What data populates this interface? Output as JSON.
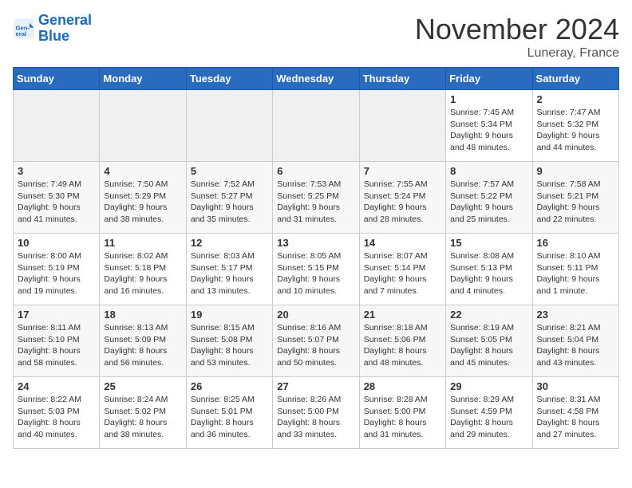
{
  "logo": {
    "text_general": "General",
    "text_blue": "Blue"
  },
  "header": {
    "month": "November 2024",
    "location": "Luneray, France"
  },
  "weekdays": [
    "Sunday",
    "Monday",
    "Tuesday",
    "Wednesday",
    "Thursday",
    "Friday",
    "Saturday"
  ],
  "weeks": [
    [
      {
        "day": "",
        "info": ""
      },
      {
        "day": "",
        "info": ""
      },
      {
        "day": "",
        "info": ""
      },
      {
        "day": "",
        "info": ""
      },
      {
        "day": "",
        "info": ""
      },
      {
        "day": "1",
        "info": "Sunrise: 7:45 AM\nSunset: 5:34 PM\nDaylight: 9 hours\nand 48 minutes."
      },
      {
        "day": "2",
        "info": "Sunrise: 7:47 AM\nSunset: 5:32 PM\nDaylight: 9 hours\nand 44 minutes."
      }
    ],
    [
      {
        "day": "3",
        "info": "Sunrise: 7:49 AM\nSunset: 5:30 PM\nDaylight: 9 hours\nand 41 minutes."
      },
      {
        "day": "4",
        "info": "Sunrise: 7:50 AM\nSunset: 5:29 PM\nDaylight: 9 hours\nand 38 minutes."
      },
      {
        "day": "5",
        "info": "Sunrise: 7:52 AM\nSunset: 5:27 PM\nDaylight: 9 hours\nand 35 minutes."
      },
      {
        "day": "6",
        "info": "Sunrise: 7:53 AM\nSunset: 5:25 PM\nDaylight: 9 hours\nand 31 minutes."
      },
      {
        "day": "7",
        "info": "Sunrise: 7:55 AM\nSunset: 5:24 PM\nDaylight: 9 hours\nand 28 minutes."
      },
      {
        "day": "8",
        "info": "Sunrise: 7:57 AM\nSunset: 5:22 PM\nDaylight: 9 hours\nand 25 minutes."
      },
      {
        "day": "9",
        "info": "Sunrise: 7:58 AM\nSunset: 5:21 PM\nDaylight: 9 hours\nand 22 minutes."
      }
    ],
    [
      {
        "day": "10",
        "info": "Sunrise: 8:00 AM\nSunset: 5:19 PM\nDaylight: 9 hours\nand 19 minutes."
      },
      {
        "day": "11",
        "info": "Sunrise: 8:02 AM\nSunset: 5:18 PM\nDaylight: 9 hours\nand 16 minutes."
      },
      {
        "day": "12",
        "info": "Sunrise: 8:03 AM\nSunset: 5:17 PM\nDaylight: 9 hours\nand 13 minutes."
      },
      {
        "day": "13",
        "info": "Sunrise: 8:05 AM\nSunset: 5:15 PM\nDaylight: 9 hours\nand 10 minutes."
      },
      {
        "day": "14",
        "info": "Sunrise: 8:07 AM\nSunset: 5:14 PM\nDaylight: 9 hours\nand 7 minutes."
      },
      {
        "day": "15",
        "info": "Sunrise: 8:08 AM\nSunset: 5:13 PM\nDaylight: 9 hours\nand 4 minutes."
      },
      {
        "day": "16",
        "info": "Sunrise: 8:10 AM\nSunset: 5:11 PM\nDaylight: 9 hours\nand 1 minute."
      }
    ],
    [
      {
        "day": "17",
        "info": "Sunrise: 8:11 AM\nSunset: 5:10 PM\nDaylight: 8 hours\nand 58 minutes."
      },
      {
        "day": "18",
        "info": "Sunrise: 8:13 AM\nSunset: 5:09 PM\nDaylight: 8 hours\nand 56 minutes."
      },
      {
        "day": "19",
        "info": "Sunrise: 8:15 AM\nSunset: 5:08 PM\nDaylight: 8 hours\nand 53 minutes."
      },
      {
        "day": "20",
        "info": "Sunrise: 8:16 AM\nSunset: 5:07 PM\nDaylight: 8 hours\nand 50 minutes."
      },
      {
        "day": "21",
        "info": "Sunrise: 8:18 AM\nSunset: 5:06 PM\nDaylight: 8 hours\nand 48 minutes."
      },
      {
        "day": "22",
        "info": "Sunrise: 8:19 AM\nSunset: 5:05 PM\nDaylight: 8 hours\nand 45 minutes."
      },
      {
        "day": "23",
        "info": "Sunrise: 8:21 AM\nSunset: 5:04 PM\nDaylight: 8 hours\nand 43 minutes."
      }
    ],
    [
      {
        "day": "24",
        "info": "Sunrise: 8:22 AM\nSunset: 5:03 PM\nDaylight: 8 hours\nand 40 minutes."
      },
      {
        "day": "25",
        "info": "Sunrise: 8:24 AM\nSunset: 5:02 PM\nDaylight: 8 hours\nand 38 minutes."
      },
      {
        "day": "26",
        "info": "Sunrise: 8:25 AM\nSunset: 5:01 PM\nDaylight: 8 hours\nand 36 minutes."
      },
      {
        "day": "27",
        "info": "Sunrise: 8:26 AM\nSunset: 5:00 PM\nDaylight: 8 hours\nand 33 minutes."
      },
      {
        "day": "28",
        "info": "Sunrise: 8:28 AM\nSunset: 5:00 PM\nDaylight: 8 hours\nand 31 minutes."
      },
      {
        "day": "29",
        "info": "Sunrise: 8:29 AM\nSunset: 4:59 PM\nDaylight: 8 hours\nand 29 minutes."
      },
      {
        "day": "30",
        "info": "Sunrise: 8:31 AM\nSunset: 4:58 PM\nDaylight: 8 hours\nand 27 minutes."
      }
    ]
  ]
}
